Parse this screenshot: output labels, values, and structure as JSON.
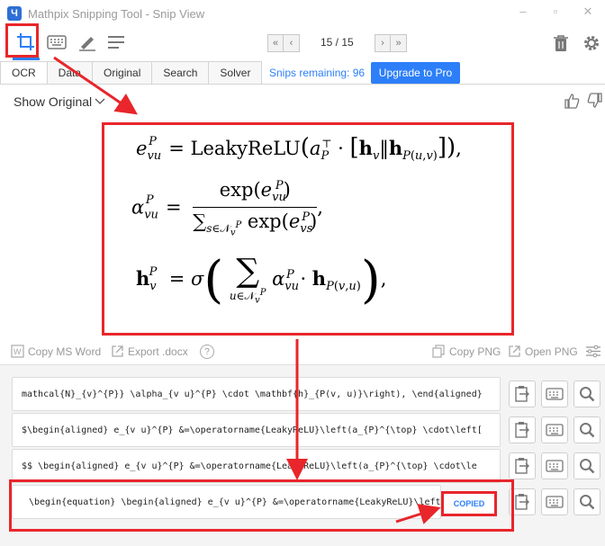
{
  "window": {
    "title": "Mathpix Snipping Tool - Snip View",
    "logo_letter": "Ч"
  },
  "toolbar": {
    "tools": [
      "crop-capture-icon",
      "keyboard-icon",
      "handwriting-pen-icon",
      "menu-lines-icon"
    ],
    "page_count": "15 / 15",
    "right_tools": [
      "trash-icon",
      "gear-icon"
    ]
  },
  "tabs": [
    {
      "label": "OCR",
      "active": true
    },
    {
      "label": "Data",
      "active": false
    },
    {
      "label": "Original",
      "active": false
    },
    {
      "label": "Search",
      "active": false
    },
    {
      "label": "Solver",
      "active": false
    }
  ],
  "account": {
    "snips_remaining": "Snips remaining: 96",
    "upgrade_label": "Upgrade to Pro"
  },
  "view": {
    "show_original": "Show Original"
  },
  "copy_actions": {
    "copy_ms_word": "Copy MS Word",
    "export_docx": "Export .docx",
    "help": "?",
    "copy_png": "Copy PNG",
    "open_png": "Open PNG"
  },
  "formats": [
    {
      "text": "mathcal{N}_{v}^{P}} \\alpha_{v u}^{P} \\cdot \\mathbf{h}_{P(v, u)}\\right), \\end{aligned}"
    },
    {
      "text": "$\\begin{aligned} e_{v u}^{P} &=\\operatorname{LeakyReLU}\\left(a_{P}^{\\top} \\cdot\\left["
    },
    {
      "text": "$$  \\begin{aligned} e_{v u}^{P} &=\\operatorname{LeakyReLU}\\left(a_{P}^{\\top} \\cdot\\le"
    },
    {
      "text": "\\begin{equation}  \\begin{aligned} e_{v u}^{P} &=\\operatorname{LeakyReLU}\\left(a_{P}"
    }
  ],
  "copied_label": "COPIED",
  "colors": {
    "accent": "#2d7ff9",
    "annotation_red": "#e8262b"
  }
}
